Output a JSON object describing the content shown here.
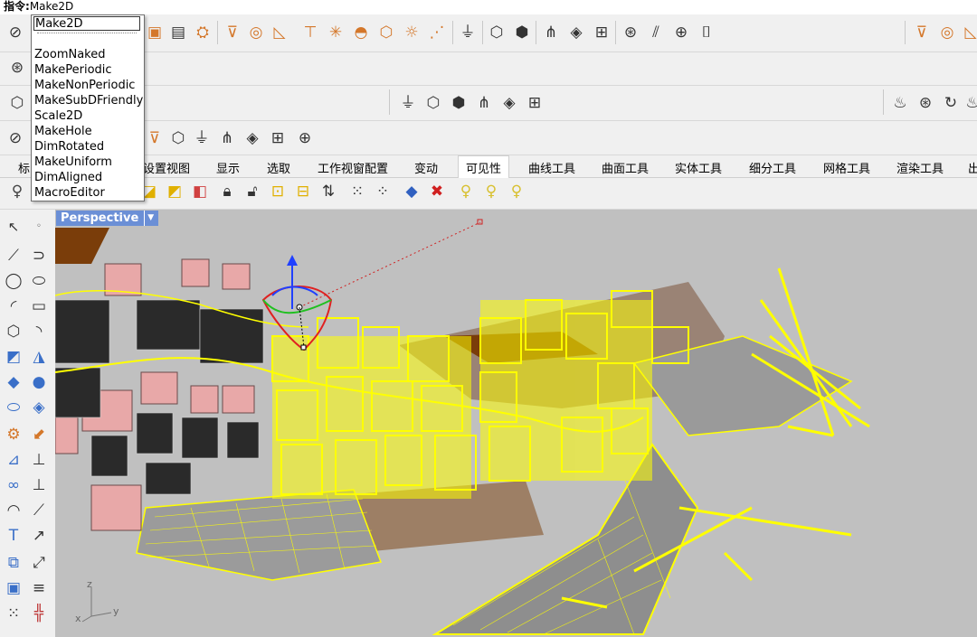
{
  "command": {
    "label": "指令:",
    "value": "Make2D"
  },
  "autocomplete": {
    "input": "Make2D",
    "items": [
      "ZoomNaked",
      "MakePeriodic",
      "MakeNonPeriodic",
      "MakeSubDFriendly",
      "Scale2D",
      "MakeHole",
      "DimRotated",
      "MakeUniform",
      "DimAligned",
      "MacroEditor"
    ]
  },
  "tabs": {
    "partial_first": "标",
    "items": [
      "设置视图",
      "显示",
      "选取",
      "工作视窗配置",
      "变动",
      "可见性",
      "曲线工具",
      "曲面工具",
      "实体工具",
      "细分工具",
      "网格工具",
      "渲染工具",
      "出"
    ],
    "active": "可见性"
  },
  "viewport": {
    "name": "Perspective",
    "axis_z": "z",
    "axis_x": "x",
    "axis_y": "y"
  },
  "colors": {
    "viewport_bg": "#c0c0c0",
    "selected_wire": "#ffff00",
    "terrain": "#7a3d0a",
    "pink_buildings": "#e8a8a8",
    "dark_buildings": "#2a2a2a",
    "viewport_title": "#6b8fd6",
    "icon_accent": "#d4772a"
  }
}
